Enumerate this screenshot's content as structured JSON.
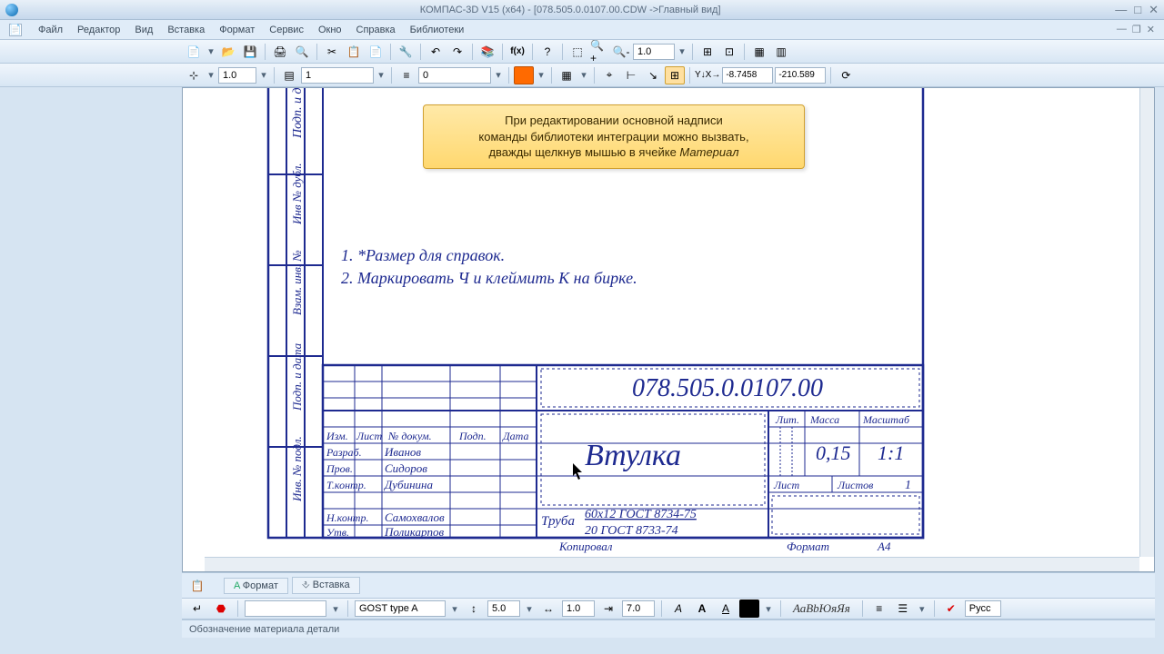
{
  "window": {
    "title": "КОМПАС-3D V15 (x64) - [078.505.0.0107.00.CDW ->Главный вид]"
  },
  "menu": {
    "file": "Файл",
    "edit": "Редактор",
    "view": "Вид",
    "insert": "Вставка",
    "format": "Формат",
    "service": "Сервис",
    "window": "Окно",
    "help": "Справка",
    "libs": "Библиотеки"
  },
  "toolbar2": {
    "scale": "1.0",
    "layer_list": "1",
    "style_list": "0",
    "zoom": "1.0",
    "coord_x": "-8.7458",
    "coord_y": "-210.589"
  },
  "hint": {
    "line1": "При редактировании основной надписи",
    "line2": "команды библиотеки интеграции можно вызвать,",
    "line3_a": "дважды щелкнув мышью в ячейке ",
    "line3_b": "Материал"
  },
  "notes": {
    "n1": "1.   *Размер для справок.",
    "n2": "2. Маркировать Ч и клеймить К на бирке."
  },
  "titleblock": {
    "doc_number": "078.505.0.0107.00",
    "part_name": "Втулка",
    "headers": {
      "izm": "Изм.",
      "list": "Лист",
      "ndokum": "№ докум.",
      "podp": "Подп.",
      "data": "Дата",
      "lit": "Лит.",
      "massa": "Масса",
      "mashtab": "Масштаб",
      "list2": "Лист",
      "listov": "Листов"
    },
    "roles": {
      "razrab": "Разраб.",
      "prov": "Пров.",
      "tkontr": "Т.контр.",
      "nkontr": "Н.контр.",
      "utv": "Утв."
    },
    "names": {
      "razrab": "Иванов",
      "prov": "Сидоров",
      "tkontr": "Дубинина",
      "nkontr": "Самохвалов",
      "utv": "Поликарпов"
    },
    "massa_val": "0,15",
    "mashtab_val": "1:1",
    "listov_val": "1",
    "material": {
      "prefix": "Труба",
      "line1": "60x12 ГОСТ 8734-75",
      "line2": "20 ГОСТ 8733-74"
    },
    "footer": {
      "kopiroval": "Копировал",
      "format": "Формат",
      "a4": "А4"
    },
    "side": {
      "podp_data": "Подп. и дата",
      "inv_dubl": "Инв № дубл.",
      "vzam_inv": "Взам. инв. №",
      "podp_data2": "Подп. и дата",
      "inv_podl": "Инв. № подл."
    }
  },
  "propbar": {
    "font": "GOST type A",
    "size": "5.0",
    "stretch": "1.0",
    "spacing": "7.0",
    "preview": "АаВbЮяЯя",
    "lang": "Русс"
  },
  "tabs": {
    "format": "Формат",
    "insert": "Вставка"
  },
  "status": {
    "text": "Обозначение материала детали"
  }
}
